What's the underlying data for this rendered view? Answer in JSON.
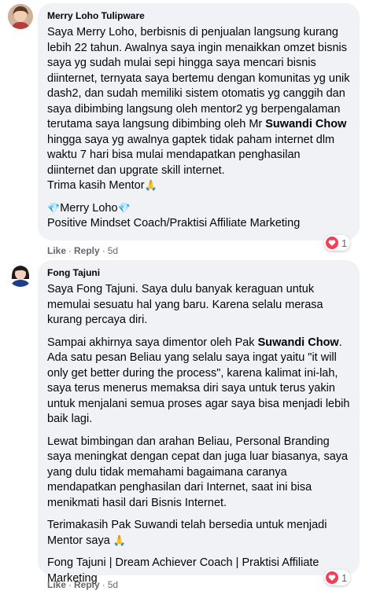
{
  "comments": [
    {
      "author": "Merry Loho Tulipware",
      "paragraphs": [
        [
          {
            "t": "Saya Merry Loho, berbisnis di penjualan langsung kurang lebih 22 tahun. Awalnya saya ingin menaikkan omzet bisnis saya yg sudah mulai sepi hingga saya mencari bisnis diinternet, ternyata saya bertemu dengan komunitas yg unik dash2, dan sudah memiliki sistem otomatis yg canggih dan saya dibimbing langsung oleh mentor2 yg berpengalaman terutama saya langsung dibimbing oleh Mr "
          },
          {
            "t": "Suwandi Chow",
            "b": true
          },
          {
            "t": " hingga saya yg awalnya gaptek tidak paham internet dlm waktu 7 hari bisa mulai mendapatkan penghasilan diinternet dan upgrate skill internet."
          }
        ],
        [
          {
            "t": "Trima kasih Mentor"
          },
          {
            "e": "🙏",
            "c": "pray"
          }
        ],
        [
          {
            "e": "💎",
            "c": "diamond"
          },
          {
            "t": "Merry Loho"
          },
          {
            "e": "💎",
            "c": "diamond"
          }
        ],
        [
          {
            "t": "Positive Mindset Coach/Praktisi Affiliate Marketing"
          }
        ]
      ],
      "paragraph_gaps": [
        false,
        false,
        true,
        false
      ],
      "actions": {
        "like": "Like",
        "reply": "Reply",
        "time": "5d"
      },
      "reaction_count": "1"
    },
    {
      "author": "Fong Tajuni",
      "paragraphs": [
        [
          {
            "t": "Saya Fong Tajuni. Saya dulu banyak keraguan untuk memulai sesuatu hal yang baru. Karena selalu merasa kurang percaya diri."
          }
        ],
        [
          {
            "t": "Sampai akhirnya saya dimentor oleh Pak "
          },
          {
            "t": "Suwandi Chow",
            "b": true
          },
          {
            "t": ". Ada satu pesan Beliau yang selalu saya ingat yaitu \"it will only get better during the process\", karena kalimat ini-lah, saya terus menerus memaksa diri saya untuk terus yakin untuk menjalani semua proses agar saya bisa menjadi lebih baik lagi."
          }
        ],
        [
          {
            "t": "Lewat bimbingan dan arahan Beliau, Personal Branding saya meningkat dengan cepat dan juga luar biasanya, saya yang dulu tidak memahami bagaimana caranya mendapatkan penghasilan dari Internet, saat ini bisa menikmati hasil dari Bisnis Internet."
          }
        ],
        [
          {
            "t": "Terimakasih Pak Suwandi telah bersedia untuk menjadi Mentor saya "
          },
          {
            "e": "🙏",
            "c": "pray"
          }
        ],
        [
          {
            "t": "Fong Tajuni | Dream Achiever Coach | Praktisi Affiliate Marketing"
          }
        ]
      ],
      "paragraph_gaps": [
        false,
        true,
        true,
        true,
        true
      ],
      "actions": {
        "like": "Like",
        "reply": "Reply",
        "time": "5d"
      },
      "reaction_count": "1"
    }
  ],
  "colors": {
    "bubble": "#f0f2f5",
    "meta": "#65676b",
    "heart": "#f33e58"
  }
}
